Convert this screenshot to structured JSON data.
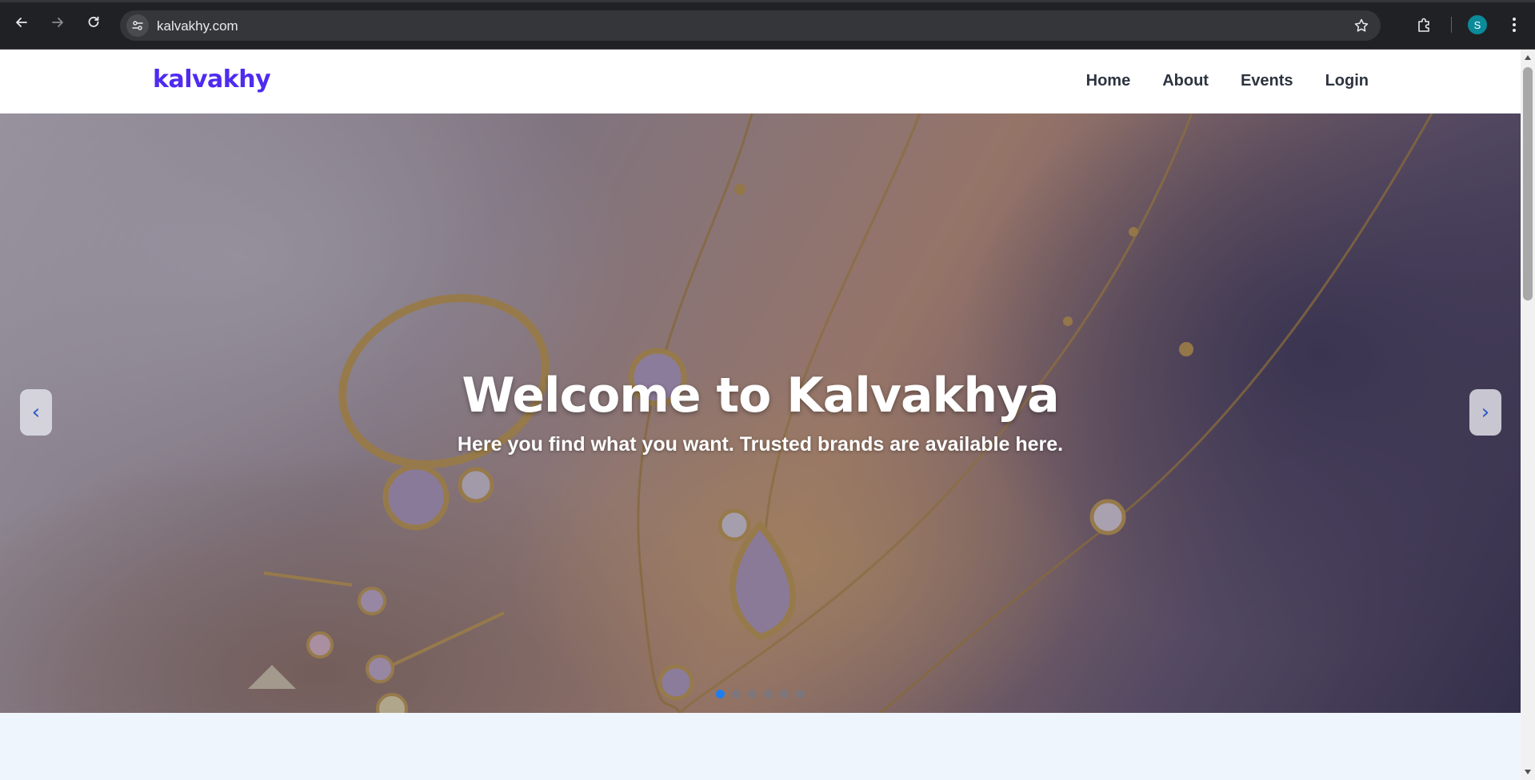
{
  "browser": {
    "url": "kalvakhy.com",
    "profile_initial": "S",
    "colors": {
      "chrome_bg": "#202124",
      "omnibox_bg": "#35363a",
      "profile_bg": "#0b8a9a"
    }
  },
  "site": {
    "brand": "kalvakhy",
    "brand_color": "#4f2bf0",
    "nav": [
      {
        "label": "Home"
      },
      {
        "label": "About"
      },
      {
        "label": "Events"
      },
      {
        "label": "Login"
      }
    ]
  },
  "hero": {
    "title": "Welcome to Kalvakhya",
    "subtitle": "Here you find what you want. Trusted brands are available here.",
    "prev_label": "‹",
    "next_label": "›",
    "slide_count": 6,
    "active_slide": 1,
    "image_subject": "gold jewelry with amethyst stones: ring, necklaces, earrings",
    "active_dot_color": "#1e7ef0"
  }
}
